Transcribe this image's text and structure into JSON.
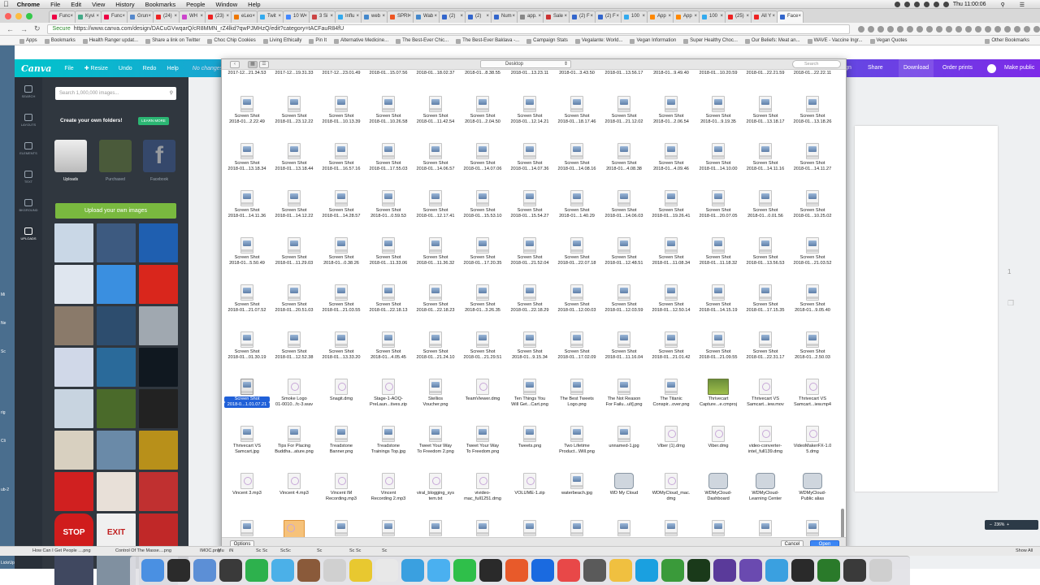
{
  "menubar": {
    "items": [
      "Chrome",
      "File",
      "Edit",
      "View",
      "History",
      "Bookmarks",
      "People",
      "Window",
      "Help"
    ],
    "clock": "Thu 11:00:06"
  },
  "tabs": [
    {
      "label": "Func",
      "color": "#e04"
    },
    {
      "label": "Kyvi",
      "color": "#4a8"
    },
    {
      "label": "Func",
      "color": "#e04"
    },
    {
      "label": "Grun",
      "color": "#58c"
    },
    {
      "label": "(24)",
      "color": "#e22"
    },
    {
      "label": "WH",
      "color": "#c4c"
    },
    {
      "label": "(23)",
      "color": "#e22"
    },
    {
      "label": "eLeo",
      "color": "#e70"
    },
    {
      "label": "Twit",
      "color": "#3ae"
    },
    {
      "label": "10 W",
      "color": "#48f"
    },
    {
      "label": "3 Si",
      "color": "#c44"
    },
    {
      "label": "Influ",
      "color": "#3ae"
    },
    {
      "label": "web",
      "color": "#48c"
    },
    {
      "label": "SPRI",
      "color": "#e52"
    },
    {
      "label": "Wab",
      "color": "#48c"
    },
    {
      "label": "(2)",
      "color": "#36c"
    },
    {
      "label": "(2)",
      "color": "#36c"
    },
    {
      "label": "Num",
      "color": "#36c"
    },
    {
      "label": "app.",
      "color": "#888"
    },
    {
      "label": "Sale",
      "color": "#c33"
    },
    {
      "label": "(2) F",
      "color": "#36c"
    },
    {
      "label": "(2) F",
      "color": "#36c"
    },
    {
      "label": "100",
      "color": "#3ae"
    },
    {
      "label": "App",
      "color": "#f80"
    },
    {
      "label": "App",
      "color": "#f80"
    },
    {
      "label": "100",
      "color": "#3ae"
    },
    {
      "label": "(25)",
      "color": "#e22"
    },
    {
      "label": "All Y",
      "color": "#e22"
    },
    {
      "label": "Face",
      "color": "#36c",
      "active": true
    }
  ],
  "address": {
    "secure": "Secure",
    "url": "https://www.canva.com/design/DACuGVwqarQ/cR8MMN_rZ4lkd?qwPJMHzQ/edit?category=tACFauR84fU"
  },
  "bookmarks": {
    "items": [
      "Apps",
      "Bookmarks",
      "Health Ranger updat...",
      "Share a link on Twitter",
      "Choc Chip Cookies",
      "Living Ethically",
      "Pin It",
      "Alternative Medicine...",
      "The Best-Ever Chic...",
      "The Best-Ever Baklava -...",
      "Campaign Stats",
      "Vegalante: World...",
      "Vegan Information",
      "Super Healthy Choc...",
      "Our Beliefs: Meat an...",
      "WAVE - Vaccine Ingr...",
      "Vegan Quotes"
    ],
    "other": "Other Bookmarks"
  },
  "canva": {
    "logo": "Canva",
    "menu": [
      "File",
      "Resize",
      "Undo",
      "Redo",
      "Help"
    ],
    "no_changes": "No changes n",
    "right": {
      "design": "sign",
      "share": "Share",
      "download": "Download",
      "order": "Order prints",
      "public": "Make public"
    },
    "rail": [
      "SEARCH",
      "LAYOUTS",
      "ELEMENTS",
      "TEXT",
      "BKGROUND",
      "UPLOADS"
    ],
    "search_placeholder": "Search 1,000,000 images...",
    "create_folders": "Create your own folders!",
    "learn_more": "LEARN MORE",
    "upload_tabs": [
      "Uploads",
      "Purchased",
      "Facebook"
    ],
    "upload_btn": "Upload your own images",
    "zoom": "236%",
    "page_number": "1"
  },
  "dialog": {
    "location": "Desktop",
    "search": "Search",
    "options": "Options",
    "cancel": "Cancel",
    "open": "Open",
    "top_names": [
      "2017-12...21.34.53",
      "2017-12...19.31.33",
      "2017-12...23.01.49",
      "2018-01...15.07.56",
      "2018-01...18.02.37",
      "2018-01...8.38.55",
      "2018-01...13.23.11",
      "2018-01...3.43.50",
      "2018-01...13.56.17",
      "2018-01...9.49.40",
      "2018-01...10.20.59",
      "2018-01...22.21.59",
      "2018-01...22.22.11"
    ],
    "rows": [
      [
        [
          "Screen Shot",
          "2018-01...2.22.49"
        ],
        [
          "Screen Shot",
          "2018-01...23.12.22"
        ],
        [
          "Screen Shot",
          "2018-01...10.13.39"
        ],
        [
          "Screen Shot",
          "2018-01...10.26.58"
        ],
        [
          "Screen Shot",
          "2018-01...11.42.54"
        ],
        [
          "Screen Shot",
          "2018-01...2.04.50"
        ],
        [
          "Screen Shot",
          "2018-01...12.14.21"
        ],
        [
          "Screen Shot",
          "2018-01...18.17.46"
        ],
        [
          "Screen Shot",
          "2018-01...21.12.02"
        ],
        [
          "Screen Shot",
          "2018-01...2.06.54"
        ],
        [
          "Screen Shot",
          "2018-01...9.19.35"
        ],
        [
          "Screen Shot",
          "2018-01...13.18.17"
        ],
        [
          "Screen Shot",
          "2018-01...13.18.26"
        ]
      ],
      [
        [
          "Screen Shot",
          "2018-01...13.18.34"
        ],
        [
          "Screen Shot",
          "2018-01...13.18.44"
        ],
        [
          "Screen Shot",
          "2018-01...16.57.16"
        ],
        [
          "Screen Shot",
          "2018-01...17.55.03"
        ],
        [
          "Screen Shot",
          "2018-01...14.06.57"
        ],
        [
          "Screen Shot",
          "2018-01...14.07.06"
        ],
        [
          "Screen Shot",
          "2018-01...14.07.36"
        ],
        [
          "Screen Shot",
          "2018-01...14.08.16"
        ],
        [
          "Screen Shot",
          "2018-01...4.08.38"
        ],
        [
          "Screen Shot",
          "2018-01...4.09.46"
        ],
        [
          "Screen Shot",
          "2018-01...14.10.00"
        ],
        [
          "Screen Shot",
          "2018-01...14.11.16"
        ],
        [
          "Screen Shot",
          "2018-01...14.11.27"
        ]
      ],
      [
        [
          "Screen Shot",
          "2018-01...14.11.36"
        ],
        [
          "Screen Shot",
          "2018-01...14.12.22"
        ],
        [
          "Screen Shot",
          "2018-01...14.28.57"
        ],
        [
          "Screen Shot",
          "2018-01...0.59.53"
        ],
        [
          "Screen Shot",
          "2018-01...12.17.41"
        ],
        [
          "Screen Shot",
          "2018-01...15.53.10"
        ],
        [
          "Screen Shot",
          "2018-01...15.54.27"
        ],
        [
          "Screen Shot",
          "2018-01...1.40.29"
        ],
        [
          "Screen Shot",
          "2018-01...14.06.03"
        ],
        [
          "Screen Shot",
          "2018-01...19.26.41"
        ],
        [
          "Screen Shot",
          "2018-01...20.07.05"
        ],
        [
          "Screen Shot",
          "2018-01...0.01.56"
        ],
        [
          "Screen Shot",
          "2018-01...10.25.02"
        ]
      ],
      [
        [
          "Screen Shot",
          "2018-01...5.50.49"
        ],
        [
          "Screen Shot",
          "2018-01...11.29.03"
        ],
        [
          "Screen Shot",
          "2018-01...0.38.26"
        ],
        [
          "Screen Shot",
          "2018-01...11.33.06"
        ],
        [
          "Screen Shot",
          "2018-01...11.36.32"
        ],
        [
          "Screen Shot",
          "2018-01...17.20.35"
        ],
        [
          "Screen Shot",
          "2018-01...21.52.04"
        ],
        [
          "Screen Shot",
          "2018-01...22.07.18"
        ],
        [
          "Screen Shot",
          "2018-01...12.48.51"
        ],
        [
          "Screen Shot",
          "2018-01...11.08.34"
        ],
        [
          "Screen Shot",
          "2018-01...11.18.32"
        ],
        [
          "Screen Shot",
          "2018-01...13.56.53"
        ],
        [
          "Screen Shot",
          "2018-01...21.03.52"
        ]
      ],
      [
        [
          "Screen Shot",
          "2018-01...21.07.52"
        ],
        [
          "Screen Shot",
          "2018-01...20.51.03"
        ],
        [
          "Screen Shot",
          "2018-01...21.03.55"
        ],
        [
          "Screen Shot",
          "2018-01...22.18.13"
        ],
        [
          "Screen Shot",
          "2018-01...22.18.23"
        ],
        [
          "Screen Shot",
          "2018-01...3.26.35"
        ],
        [
          "Screen Shot",
          "2018-01...22.18.29"
        ],
        [
          "Screen Shot",
          "2018-01...12.00.03"
        ],
        [
          "Screen Shot",
          "2018-01...12.03.59"
        ],
        [
          "Screen Shot",
          "2018-01...12.50.14"
        ],
        [
          "Screen Shot",
          "2018-01...14.15.19"
        ],
        [
          "Screen Shot",
          "2018-01...17.15.35"
        ],
        [
          "Screen Shot",
          "2018-01...9.05.40"
        ]
      ],
      [
        [
          "Screen Shot",
          "2018-01...01.30.19"
        ],
        [
          "Screen Shot",
          "2018-01...12.52.38"
        ],
        [
          "Screen Shot",
          "2018-01...13.33.20"
        ],
        [
          "Screen Shot",
          "2018-01...4.05.45"
        ],
        [
          "Screen Shot",
          "2018-01...21.24.10"
        ],
        [
          "Screen Shot",
          "2018-01...21.29.51"
        ],
        [
          "Screen Shot",
          "2018-01...9.15.34"
        ],
        [
          "Screen Shot",
          "2018-01...17.02.09"
        ],
        [
          "Screen Shot",
          "2018-01...11.16.04"
        ],
        [
          "Screen Shot",
          "2018-01...21.01.42"
        ],
        [
          "Screen Shot",
          "2018-01...21.09.55"
        ],
        [
          "Screen Shot",
          "2018-01...22.31.17"
        ],
        [
          "Screen Shot",
          "2018-01...2.50.03"
        ]
      ],
      [
        [
          "Screen Shot",
          "2018-0...1.01.07.21"
        ],
        [
          "Smoke Logo",
          "01-0010...fc-3.wav"
        ],
        [
          "Snagit.dmg",
          ""
        ],
        [
          "Stage-1-AOQ-",
          "PreLaun...tives.zip"
        ],
        [
          "Stellios",
          "Voucher.png"
        ],
        [
          "TeamViewer.dmg",
          ""
        ],
        [
          "Ten Things You",
          "Will Get...Cart.png"
        ],
        [
          "The Best Tweets",
          "Logo.png"
        ],
        [
          "The Not Reason",
          "For Failu...ult].png"
        ],
        [
          "The Titanic",
          "Conspir...over.png"
        ],
        [
          "Thrivecart",
          "Capture...e.cmproj"
        ],
        [
          "Thrivecart VS",
          "Samcart...iew.mov"
        ],
        [
          "Thrivecart VS",
          "Samcart...iew.mp4"
        ]
      ],
      [
        [
          "Thrivecart VS",
          "Samcart.jpg"
        ],
        [
          "Tips For Placing",
          "Buddha...ature.png"
        ],
        [
          "Treadstone",
          "Banner.png"
        ],
        [
          "Treadstone",
          "Trainings Top.jpg"
        ],
        [
          "Tweet Your Way",
          "To Freedom 2.png"
        ],
        [
          "Tweet Your Way",
          "To Freedom.png"
        ],
        [
          "Tweets.png",
          ""
        ],
        [
          "Two Lifetime",
          "Product...Will.png"
        ],
        [
          "unnamed-1.jpg",
          ""
        ],
        [
          "Viber (1).dmg",
          ""
        ],
        [
          "Viber.dmg",
          ""
        ],
        [
          "video-converter-",
          "intel_full139.dmg"
        ],
        [
          "VideoMakerFX-1.0",
          "5.dmg"
        ]
      ],
      [
        [
          "Vincent 3.mp3",
          ""
        ],
        [
          "Vincent 4.mp3",
          ""
        ],
        [
          "Vincent IM",
          "Recording.mp3"
        ],
        [
          "Vincent",
          "Recording 2.mp3"
        ],
        [
          "viral_blogging_sys",
          "tem.txt"
        ],
        [
          "vivideo-",
          "mac_full1251.dmg"
        ],
        [
          "VOLUME-1.zip",
          ""
        ],
        [
          "waterbeach.jpg",
          ""
        ],
        [
          "WD My Cloud",
          ""
        ],
        [
          "WDMyCloud_mac.",
          "dmg"
        ],
        [
          "WDMyCloud-",
          "Dashboard"
        ],
        [
          "WDMyCloud-",
          "Learning Center"
        ],
        [
          "WDMyCloud-",
          "Public alias"
        ]
      ]
    ],
    "selected_label": [
      "Screen Shot",
      "2018-0...1.01.07.21"
    ]
  },
  "statusbar": {
    "downloads": [
      "How Can I Get People ....png",
      "Control Of The Masse....png",
      "IMOC.png",
      "Mu",
      "iN",
      "Sc Sc",
      "ScSc",
      "Sc",
      "Sc Sc",
      "Sc"
    ],
    "show_all": "Show All"
  },
  "desktop_labels": [
    "Mi",
    "Ne",
    "Sc",
    "rig",
    "Cli",
    "ub-2",
    "LickrUpl"
  ]
}
